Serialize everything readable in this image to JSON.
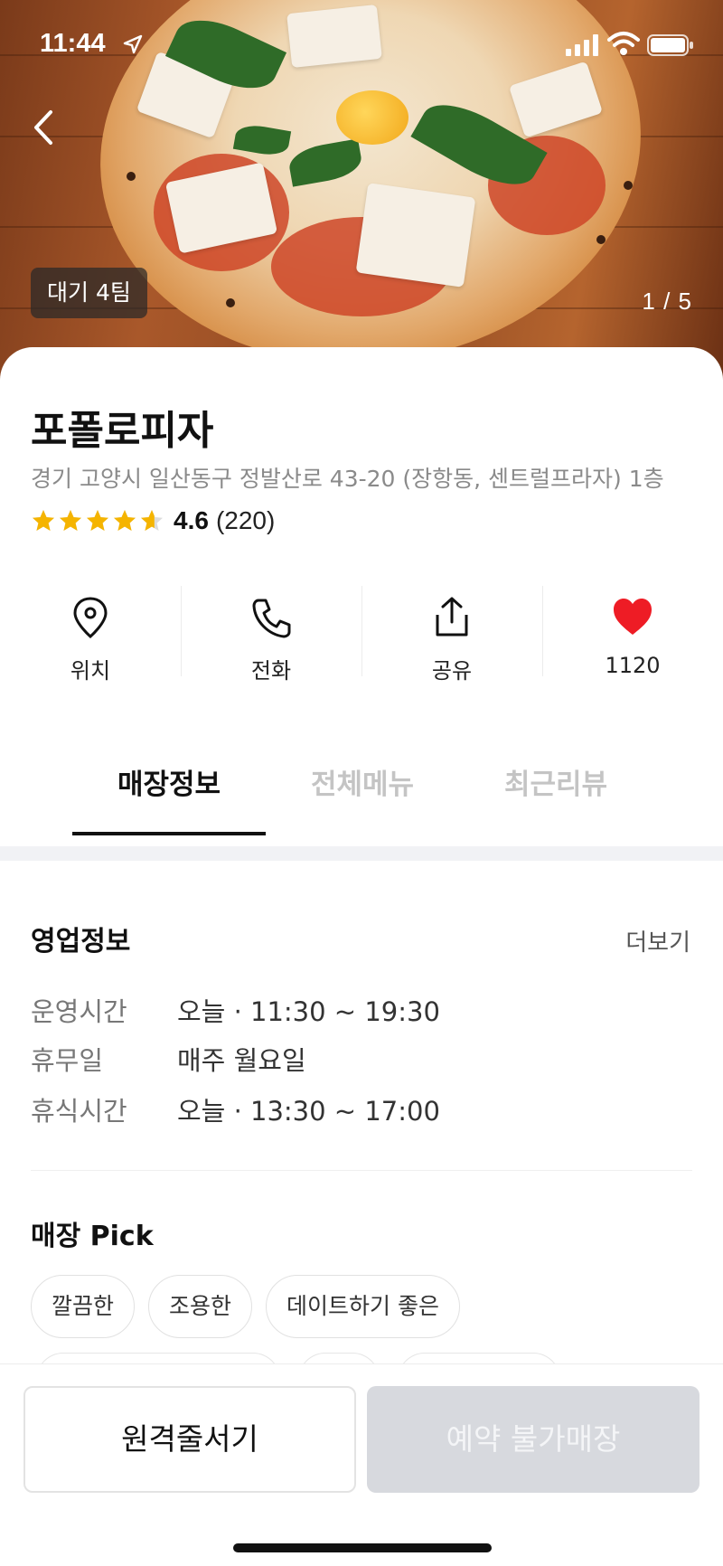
{
  "status_bar": {
    "time": "11:44"
  },
  "hero": {
    "queue_badge": "대기 4팀",
    "page_counter": "1 / 5"
  },
  "store": {
    "name": "포폴로피자",
    "address": "경기 고양시 일산동구 정발산로 43-20 (장항동, 센트럴프라자) 1층",
    "rating": "4.6",
    "review_count": "(220)",
    "rating_value": 4.6,
    "star_color": "#f5b400"
  },
  "actions": [
    {
      "label": "위치",
      "icon": "location-pin-icon"
    },
    {
      "label": "전화",
      "icon": "phone-icon"
    },
    {
      "label": "공유",
      "icon": "share-icon"
    },
    {
      "label": "1120",
      "icon": "heart-icon"
    }
  ],
  "heart_color": "#ee1c25",
  "tabs": [
    {
      "label": "매장정보",
      "active": true
    },
    {
      "label": "전체메뉴",
      "active": false
    },
    {
      "label": "최근리뷰",
      "active": false
    }
  ],
  "business_info": {
    "title": "영업정보",
    "more": "더보기",
    "rows": [
      {
        "key": "운영시간",
        "value": "오늘 · 11:30 ~ 19:30"
      },
      {
        "key": "휴무일",
        "value": "매주 월요일"
      },
      {
        "key": "휴식시간",
        "value": "오늘 · 13:30 ~ 17:00"
      }
    ]
  },
  "store_pick": {
    "title": "매장 Pick",
    "chips": [
      "깔끔한",
      "조용한",
      "데이트하기 좋은"
    ]
  },
  "bottom": {
    "queue_button": "원격줄서기",
    "reserve_button": "예약 불가매장"
  }
}
